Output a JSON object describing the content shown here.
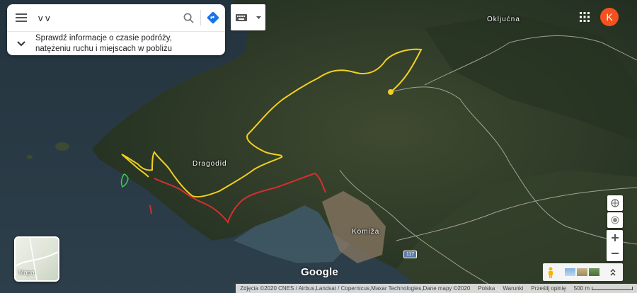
{
  "search": {
    "query": "v v",
    "suggestion_line1": "Sprawdź informacje o czasie podróży,",
    "suggestion_line2": "natężeniu ruchu i miejscach w pobliżu"
  },
  "account": {
    "initial": "K",
    "color": "#f4511e"
  },
  "map_labels": {
    "town_north": "Okljućna",
    "area_west": "Dragodid",
    "town_south": "Komiža",
    "road_number": "117"
  },
  "layer_toggle": {
    "label": "Mapa"
  },
  "logo": "Google",
  "footer": {
    "imagery": "Zdjęcia ©2020 CNES / Airbus,Landsat / Copernicus,Maxar Technologies,Dane mapy ©2020",
    "country": "Polska",
    "terms": "Warunki",
    "feedback": "Prześlij opinię",
    "scale": "500 m"
  },
  "routes": {
    "yellow_color": "#f2d021",
    "red_color": "#d32f2f",
    "green_color": "#3bd14a",
    "road_color": "#c9c3b8"
  },
  "icons": {
    "menu": "menu-icon",
    "search": "search-icon",
    "directions": "directions-icon",
    "keyboard": "keyboard-icon",
    "apps": "apps-grid-icon",
    "compass": "compass-icon",
    "location": "my-location-icon",
    "pegman": "pegman-icon",
    "expand": "chevron-up-icon"
  }
}
